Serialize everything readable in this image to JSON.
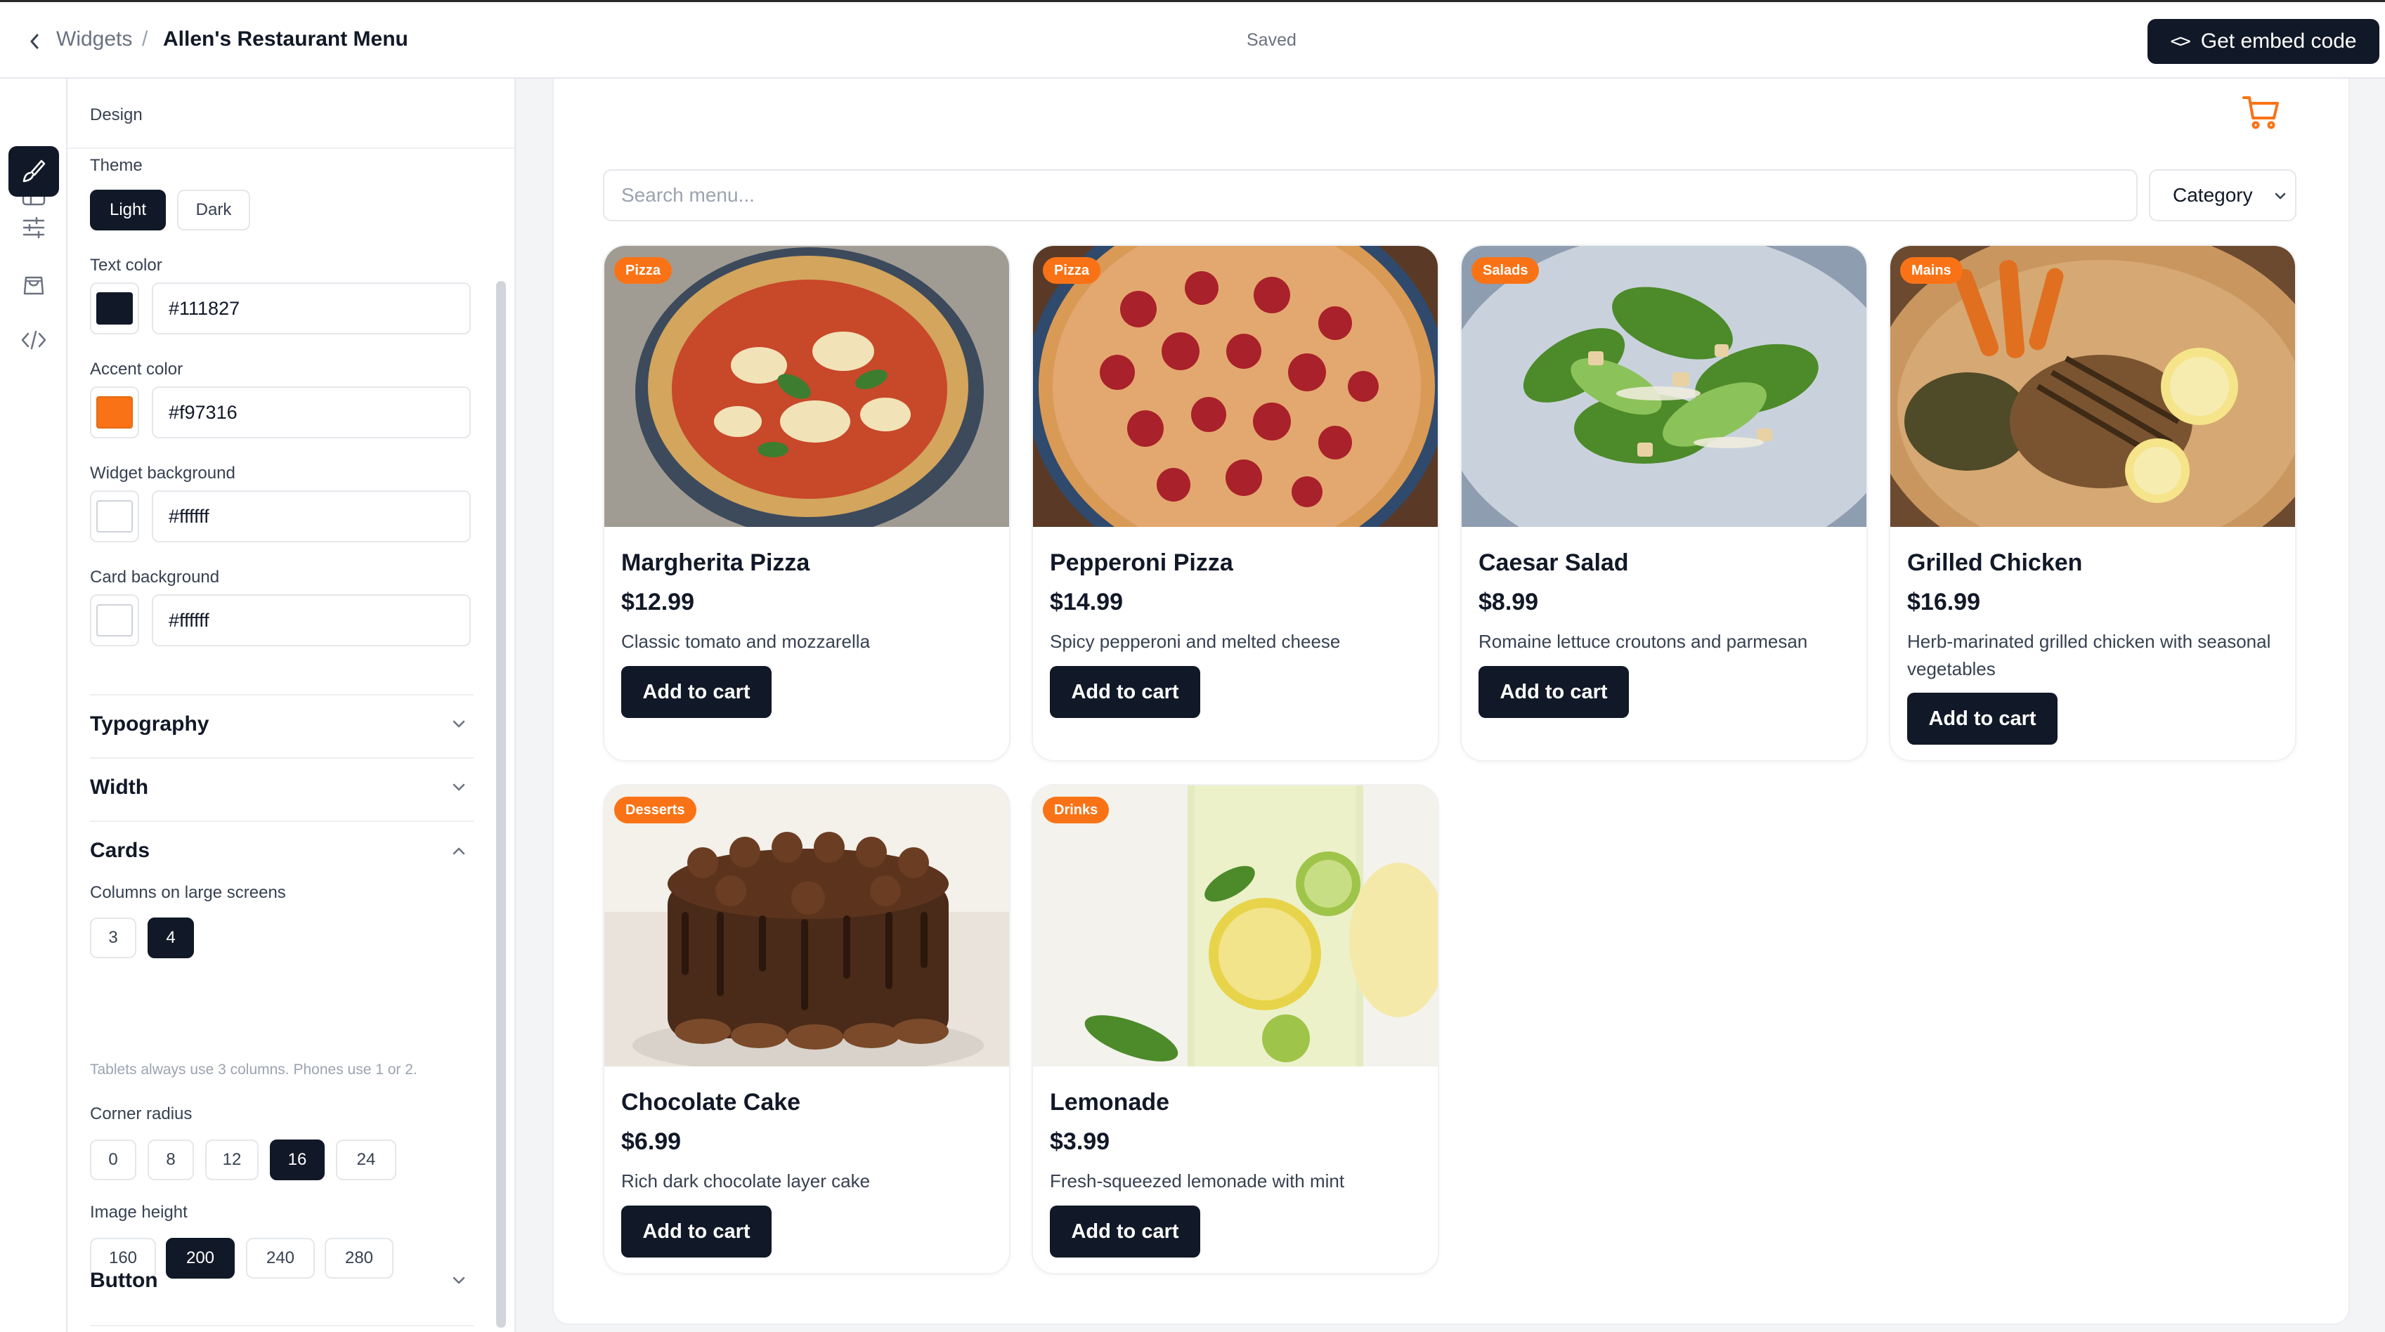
{
  "header": {
    "back_label": "Widgets",
    "separator": "/",
    "title": "Allen's Restaurant Menu",
    "status": "Saved",
    "embed_label": "Get embed code"
  },
  "rail": {
    "items": [
      "layout-icon",
      "brush-icon",
      "sliders-icon",
      "bag-icon",
      "code-icon"
    ],
    "active": "brush-icon"
  },
  "design": {
    "heading": "Design",
    "theme": {
      "label": "Theme",
      "options": [
        "Light",
        "Dark"
      ],
      "selected": "Light"
    },
    "text_color": {
      "label": "Text color",
      "value": "#111827"
    },
    "accent_color": {
      "label": "Accent color",
      "value": "#f97316"
    },
    "widget_background": {
      "label": "Widget background",
      "value": "#ffffff"
    },
    "card_background": {
      "label": "Card background",
      "value": "#ffffff"
    },
    "sections": {
      "typography": "Typography",
      "width": "Width",
      "cards": "Cards",
      "button": "Button"
    },
    "cards": {
      "columns_label": "Columns on large screens",
      "columns_options": [
        "3",
        "4"
      ],
      "columns_selected": "4",
      "hint": "Tablets always use 3 columns. Phones use 1 or 2.",
      "radius_label": "Corner radius",
      "radius_options": [
        "0",
        "8",
        "12",
        "16",
        "24"
      ],
      "radius_selected": "16",
      "image_height_label": "Image height",
      "image_height_options": [
        "160",
        "200",
        "240",
        "280"
      ],
      "image_height_selected": "200"
    }
  },
  "preview": {
    "search_placeholder": "Search menu...",
    "category_label": "Category",
    "add_label": "Add to cart",
    "items": [
      {
        "badge": "Pizza",
        "name": "Margherita Pizza",
        "price": "$12.99",
        "desc": "Classic tomato and mozzarella"
      },
      {
        "badge": "Pizza",
        "name": "Pepperoni Pizza",
        "price": "$14.99",
        "desc": "Spicy pepperoni and melted cheese"
      },
      {
        "badge": "Salads",
        "name": "Caesar Salad",
        "price": "$8.99",
        "desc": "Romaine lettuce croutons and parmesan"
      },
      {
        "badge": "Mains",
        "name": "Grilled Chicken",
        "price": "$16.99",
        "desc": "Herb-marinated grilled chicken with seasonal vegetables"
      },
      {
        "badge": "Desserts",
        "name": "Chocolate Cake",
        "price": "$6.99",
        "desc": "Rich dark chocolate layer cake"
      },
      {
        "badge": "Drinks",
        "name": "Lemonade",
        "price": "$3.99",
        "desc": "Fresh-squeezed lemonade with mint"
      }
    ]
  },
  "colors": {
    "accent": "#f97316",
    "primary": "#111827",
    "border": "#e5e7eb"
  }
}
